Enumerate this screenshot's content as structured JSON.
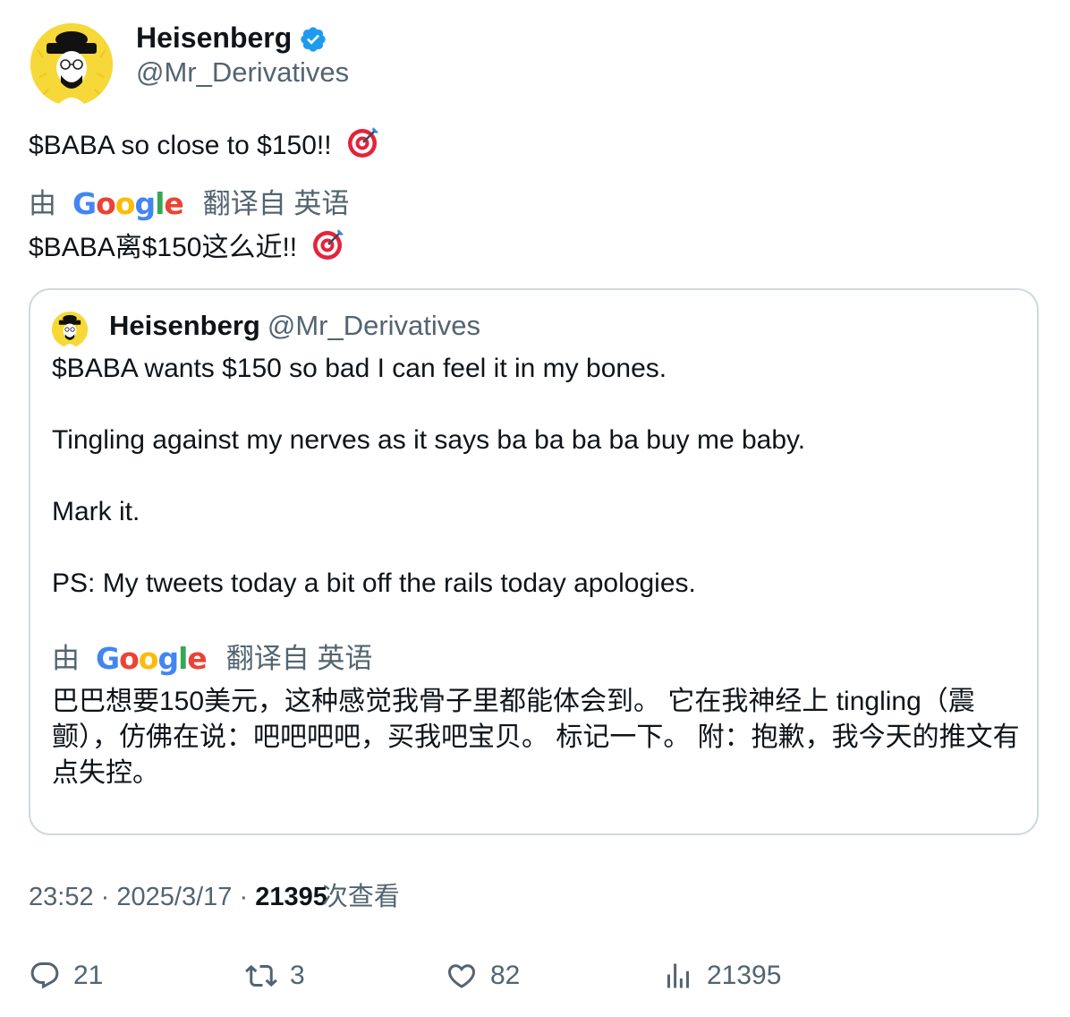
{
  "author": {
    "name": "Heisenberg",
    "handle": "@Mr_Derivatives",
    "verified": true,
    "avatar_icon": "heisenberg-avatar"
  },
  "tweet": {
    "text": "$BABA so close to $150!! ",
    "emoji": "direct-hit-target",
    "translation_by": "由",
    "translation_provider": "Google",
    "translation_from": "翻译自 英语",
    "translated_text": "$BABA离$150这么近!! "
  },
  "quote": {
    "author_name": "Heisenberg",
    "author_handle": "@Mr_Derivatives",
    "paragraphs": [
      "$BABA wants $150 so bad I can feel it in my bones.",
      "Tingling against my nerves as it says ba ba ba ba buy me baby.",
      "Mark it.",
      "PS: My tweets today a bit off the rails today apologies."
    ],
    "translation_by": "由",
    "translation_provider": "Google",
    "translation_from": "翻译自 英语",
    "translated_text": "巴巴想要150美元，这种感觉我骨子里都能体会到。 它在我神经上 tingling（震颤），仿佛在说：吧吧吧吧，买我吧宝贝。 标记一下。 附：抱歉，我今天的推文有点失控。"
  },
  "meta": {
    "time": "23:52",
    "separator": "·",
    "date": "2025/3/17",
    "views_count": "21395",
    "views_label": "次查看"
  },
  "actions": {
    "replies": "21",
    "retweets": "3",
    "likes": "82",
    "views": "21395"
  },
  "colors": {
    "secondary_text": "#536471",
    "verified_blue": "#1d9bf0",
    "border": "#cfd9de"
  }
}
